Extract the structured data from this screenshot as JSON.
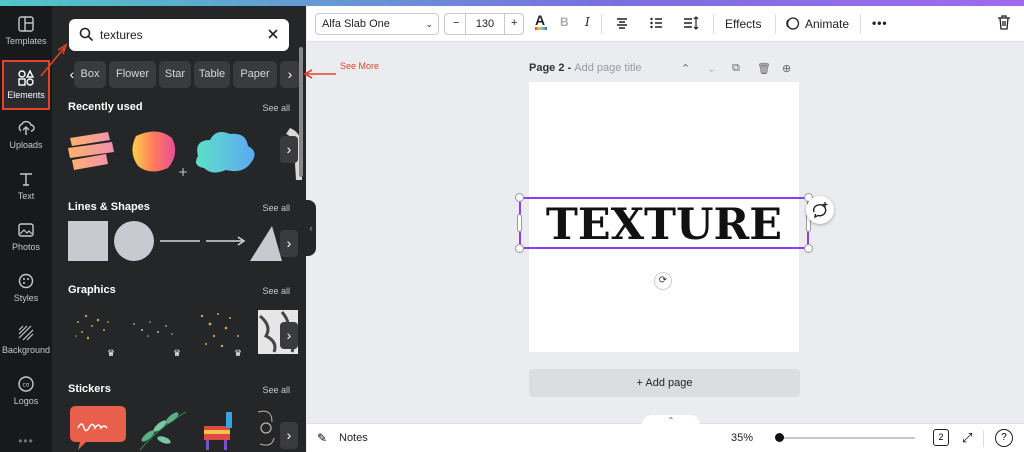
{
  "rail": {
    "items": [
      {
        "label": "Templates",
        "icon": "templates-icon"
      },
      {
        "label": "Elements",
        "icon": "elements-icon",
        "active": true
      },
      {
        "label": "Uploads",
        "icon": "upload-icon"
      },
      {
        "label": "Text",
        "icon": "text-icon"
      },
      {
        "label": "Photos",
        "icon": "photos-icon"
      },
      {
        "label": "Styles",
        "icon": "styles-icon"
      },
      {
        "label": "Background",
        "icon": "background-icon"
      },
      {
        "label": "Logos",
        "icon": "logos-icon"
      }
    ],
    "more": "•••"
  },
  "panel": {
    "search": {
      "value": "textures",
      "search_symbol": "⌕",
      "clear_symbol": "✕"
    },
    "chips": [
      "Box",
      "Flower",
      "Star",
      "Table",
      "Paper"
    ],
    "chevron_left": "‹",
    "chevron_right": "›",
    "sections": [
      {
        "title": "Recently used",
        "see_all": "See all"
      },
      {
        "title": "Lines & Shapes",
        "see_all": "See all"
      },
      {
        "title": "Graphics",
        "see_all": "See all"
      },
      {
        "title": "Stickers",
        "see_all": "See all"
      }
    ],
    "collapse_symbol": "‹"
  },
  "annotation": {
    "label": "See More",
    "color": "#e2432a"
  },
  "toolbar": {
    "font": "Alfa Slab One",
    "dropdown_symbol": "⌄",
    "minus": "−",
    "size": "130",
    "plus": "+",
    "text_color_symbol": "A",
    "bold": "B",
    "italic": "I",
    "effects": "Effects",
    "animate": "Animate",
    "more": "•••",
    "trash_symbol": "🗑"
  },
  "canvas": {
    "page_label": "Page 2 - ",
    "page_title_placeholder": "Add page title",
    "page_icons": [
      "⌃",
      "⌄",
      "⧉",
      "🗑",
      "⊕"
    ],
    "text": "TEXTURE",
    "rotate_symbol": "⟳",
    "add_page": "+ Add page"
  },
  "bottombar": {
    "notes": "Notes",
    "notes_symbol": "✎",
    "zoom": "35%",
    "page_count": "2",
    "expand_symbol": "⤢",
    "help": "?",
    "tab_symbol": "⌃"
  },
  "colors": {
    "accent": "#8b3dff",
    "annotation": "#e2432a",
    "rail_bg": "#18191b",
    "panel_bg": "#252627"
  }
}
